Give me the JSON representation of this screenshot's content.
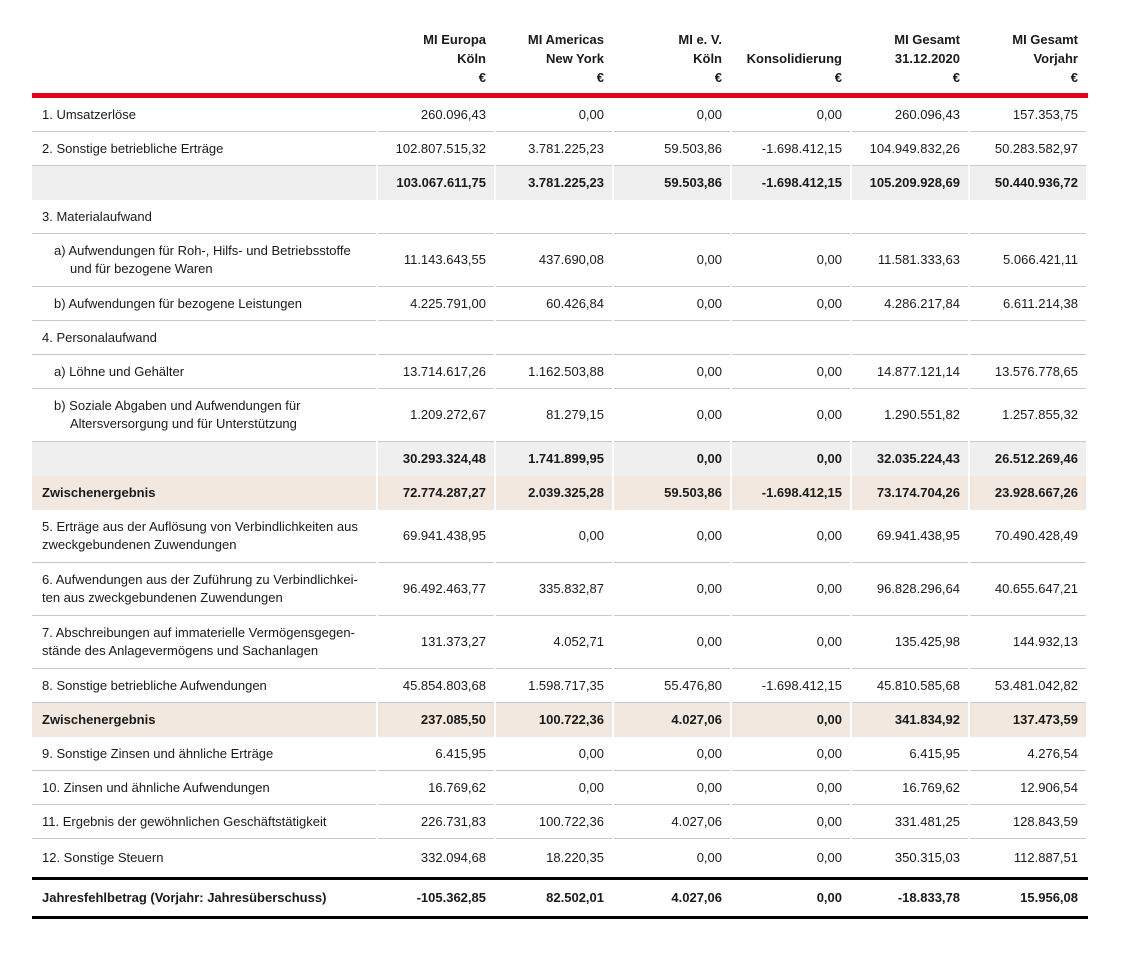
{
  "header": {
    "columns": [
      {
        "line1": "MI Europa",
        "line2": "Köln",
        "line3": "€"
      },
      {
        "line1": "MI Americas",
        "line2": "New York",
        "line3": "€"
      },
      {
        "line1": "MI e. V.",
        "line2": "Köln",
        "line3": "€"
      },
      {
        "line1": "",
        "line2": "Konsolidierung",
        "line3": "€"
      },
      {
        "line1": "MI Gesamt",
        "line2": "31.12.2020",
        "line3": "€"
      },
      {
        "line1": "MI Gesamt",
        "line2": "Vorjahr",
        "line3": "€"
      }
    ]
  },
  "rows": [
    {
      "label": "1. Umsatzerlöse",
      "label2": "",
      "values": [
        "260.096,43",
        "0,00",
        "0,00",
        "0,00",
        "260.096,43",
        "157.353,75"
      ]
    },
    {
      "label": "2. Sonstige betriebliche Erträge",
      "label2": "",
      "values": [
        "102.807.515,32",
        "3.781.225,23",
        "59.503,86",
        "-1.698.412,15",
        "104.949.832,26",
        "50.283.582,97"
      ]
    },
    {
      "label": "",
      "label2": "",
      "values": [
        "103.067.611,75",
        "3.781.225,23",
        "59.503,86",
        "-1.698.412,15",
        "105.209.928,69",
        "50.440.936,72"
      ]
    },
    {
      "label": "3. Materialaufwand",
      "label2": "",
      "values": [
        "",
        "",
        "",
        "",
        "",
        ""
      ]
    },
    {
      "label": "a) Aufwendungen für Roh-, Hilfs- und Betriebsstoffe",
      "label2": "und für bezogene Waren",
      "values": [
        "11.143.643,55",
        "437.690,08",
        "0,00",
        "0,00",
        "11.581.333,63",
        "5.066.421,11"
      ]
    },
    {
      "label": "b) Aufwendungen für bezogene Leistungen",
      "label2": "",
      "values": [
        "4.225.791,00",
        "60.426,84",
        "0,00",
        "0,00",
        "4.286.217,84",
        "6.611.214,38"
      ]
    },
    {
      "label": "4. Personalaufwand",
      "label2": "",
      "values": [
        "",
        "",
        "",
        "",
        "",
        ""
      ]
    },
    {
      "label": "a) Löhne und Gehälter",
      "label2": "",
      "values": [
        "13.714.617,26",
        "1.162.503,88",
        "0,00",
        "0,00",
        "14.877.121,14",
        "13.576.778,65"
      ]
    },
    {
      "label": "b) Soziale Abgaben und Aufwendungen für",
      "label2": "Altersversorgung und für Unterstützung",
      "values": [
        "1.209.272,67",
        "81.279,15",
        "0,00",
        "0,00",
        "1.290.551,82",
        "1.257.855,32"
      ]
    },
    {
      "label": "",
      "label2": "",
      "values": [
        "30.293.324,48",
        "1.741.899,95",
        "0,00",
        "0,00",
        "32.035.224,43",
        "26.512.269,46"
      ]
    },
    {
      "label": "Zwischenergebnis",
      "label2": "",
      "values": [
        "72.774.287,27",
        "2.039.325,28",
        "59.503,86",
        "-1.698.412,15",
        "73.174.704,26",
        "23.928.667,26"
      ]
    },
    {
      "label": "5. Erträge aus der Auflösung von Verbindlichkeiten aus",
      "label2": "zweckgebundenen Zuwendungen",
      "values": [
        "69.941.438,95",
        "0,00",
        "0,00",
        "0,00",
        "69.941.438,95",
        "70.490.428,49"
      ]
    },
    {
      "label": "6. Aufwendungen aus der Zuführung zu Verbindlichkei-",
      "label2": "ten aus zweckgebundenen Zuwendungen",
      "values": [
        "96.492.463,77",
        "335.832,87",
        "0,00",
        "0,00",
        "96.828.296,64",
        "40.655.647,21"
      ]
    },
    {
      "label": "7. Abschreibungen auf immaterielle Vermögensgegen-",
      "label2": "stände des Anlagevermögens und Sachanlagen",
      "values": [
        "131.373,27",
        "4.052,71",
        "0,00",
        "0,00",
        "135.425,98",
        "144.932,13"
      ]
    },
    {
      "label": "8. Sonstige betriebliche Aufwendungen",
      "label2": "",
      "values": [
        "45.854.803,68",
        "1.598.717,35",
        "55.476,80",
        "-1.698.412,15",
        "45.810.585,68",
        "53.481.042,82"
      ]
    },
    {
      "label": "Zwischenergebnis",
      "label2": "",
      "values": [
        "237.085,50",
        "100.722,36",
        "4.027,06",
        "0,00",
        "341.834,92",
        "137.473,59"
      ]
    },
    {
      "label": "9. Sonstige Zinsen und ähnliche Erträge",
      "label2": "",
      "values": [
        "6.415,95",
        "0,00",
        "0,00",
        "0,00",
        "6.415,95",
        "4.276,54"
      ]
    },
    {
      "label": "10. Zinsen und ähnliche Aufwendungen",
      "label2": "",
      "values": [
        "16.769,62",
        "0,00",
        "0,00",
        "0,00",
        "16.769,62",
        "12.906,54"
      ]
    },
    {
      "label": "11. Ergebnis der gewöhnlichen Geschäftstätigkeit",
      "label2": "",
      "values": [
        "226.731,83",
        "100.722,36",
        "4.027,06",
        "0,00",
        "331.481,25",
        "128.843,59"
      ]
    },
    {
      "label": "12. Sonstige Steuern",
      "label2": "",
      "values": [
        "332.094,68",
        "18.220,35",
        "0,00",
        "0,00",
        "350.315,03",
        "112.887,51"
      ]
    },
    {
      "label": "Jahresfehlbetrag (Vorjahr: Jahresüberschuss)",
      "label2": "",
      "values": [
        "-105.362,85",
        "82.502,01",
        "4.027,06",
        "0,00",
        "-18.833,78",
        "15.956,08"
      ]
    }
  ]
}
